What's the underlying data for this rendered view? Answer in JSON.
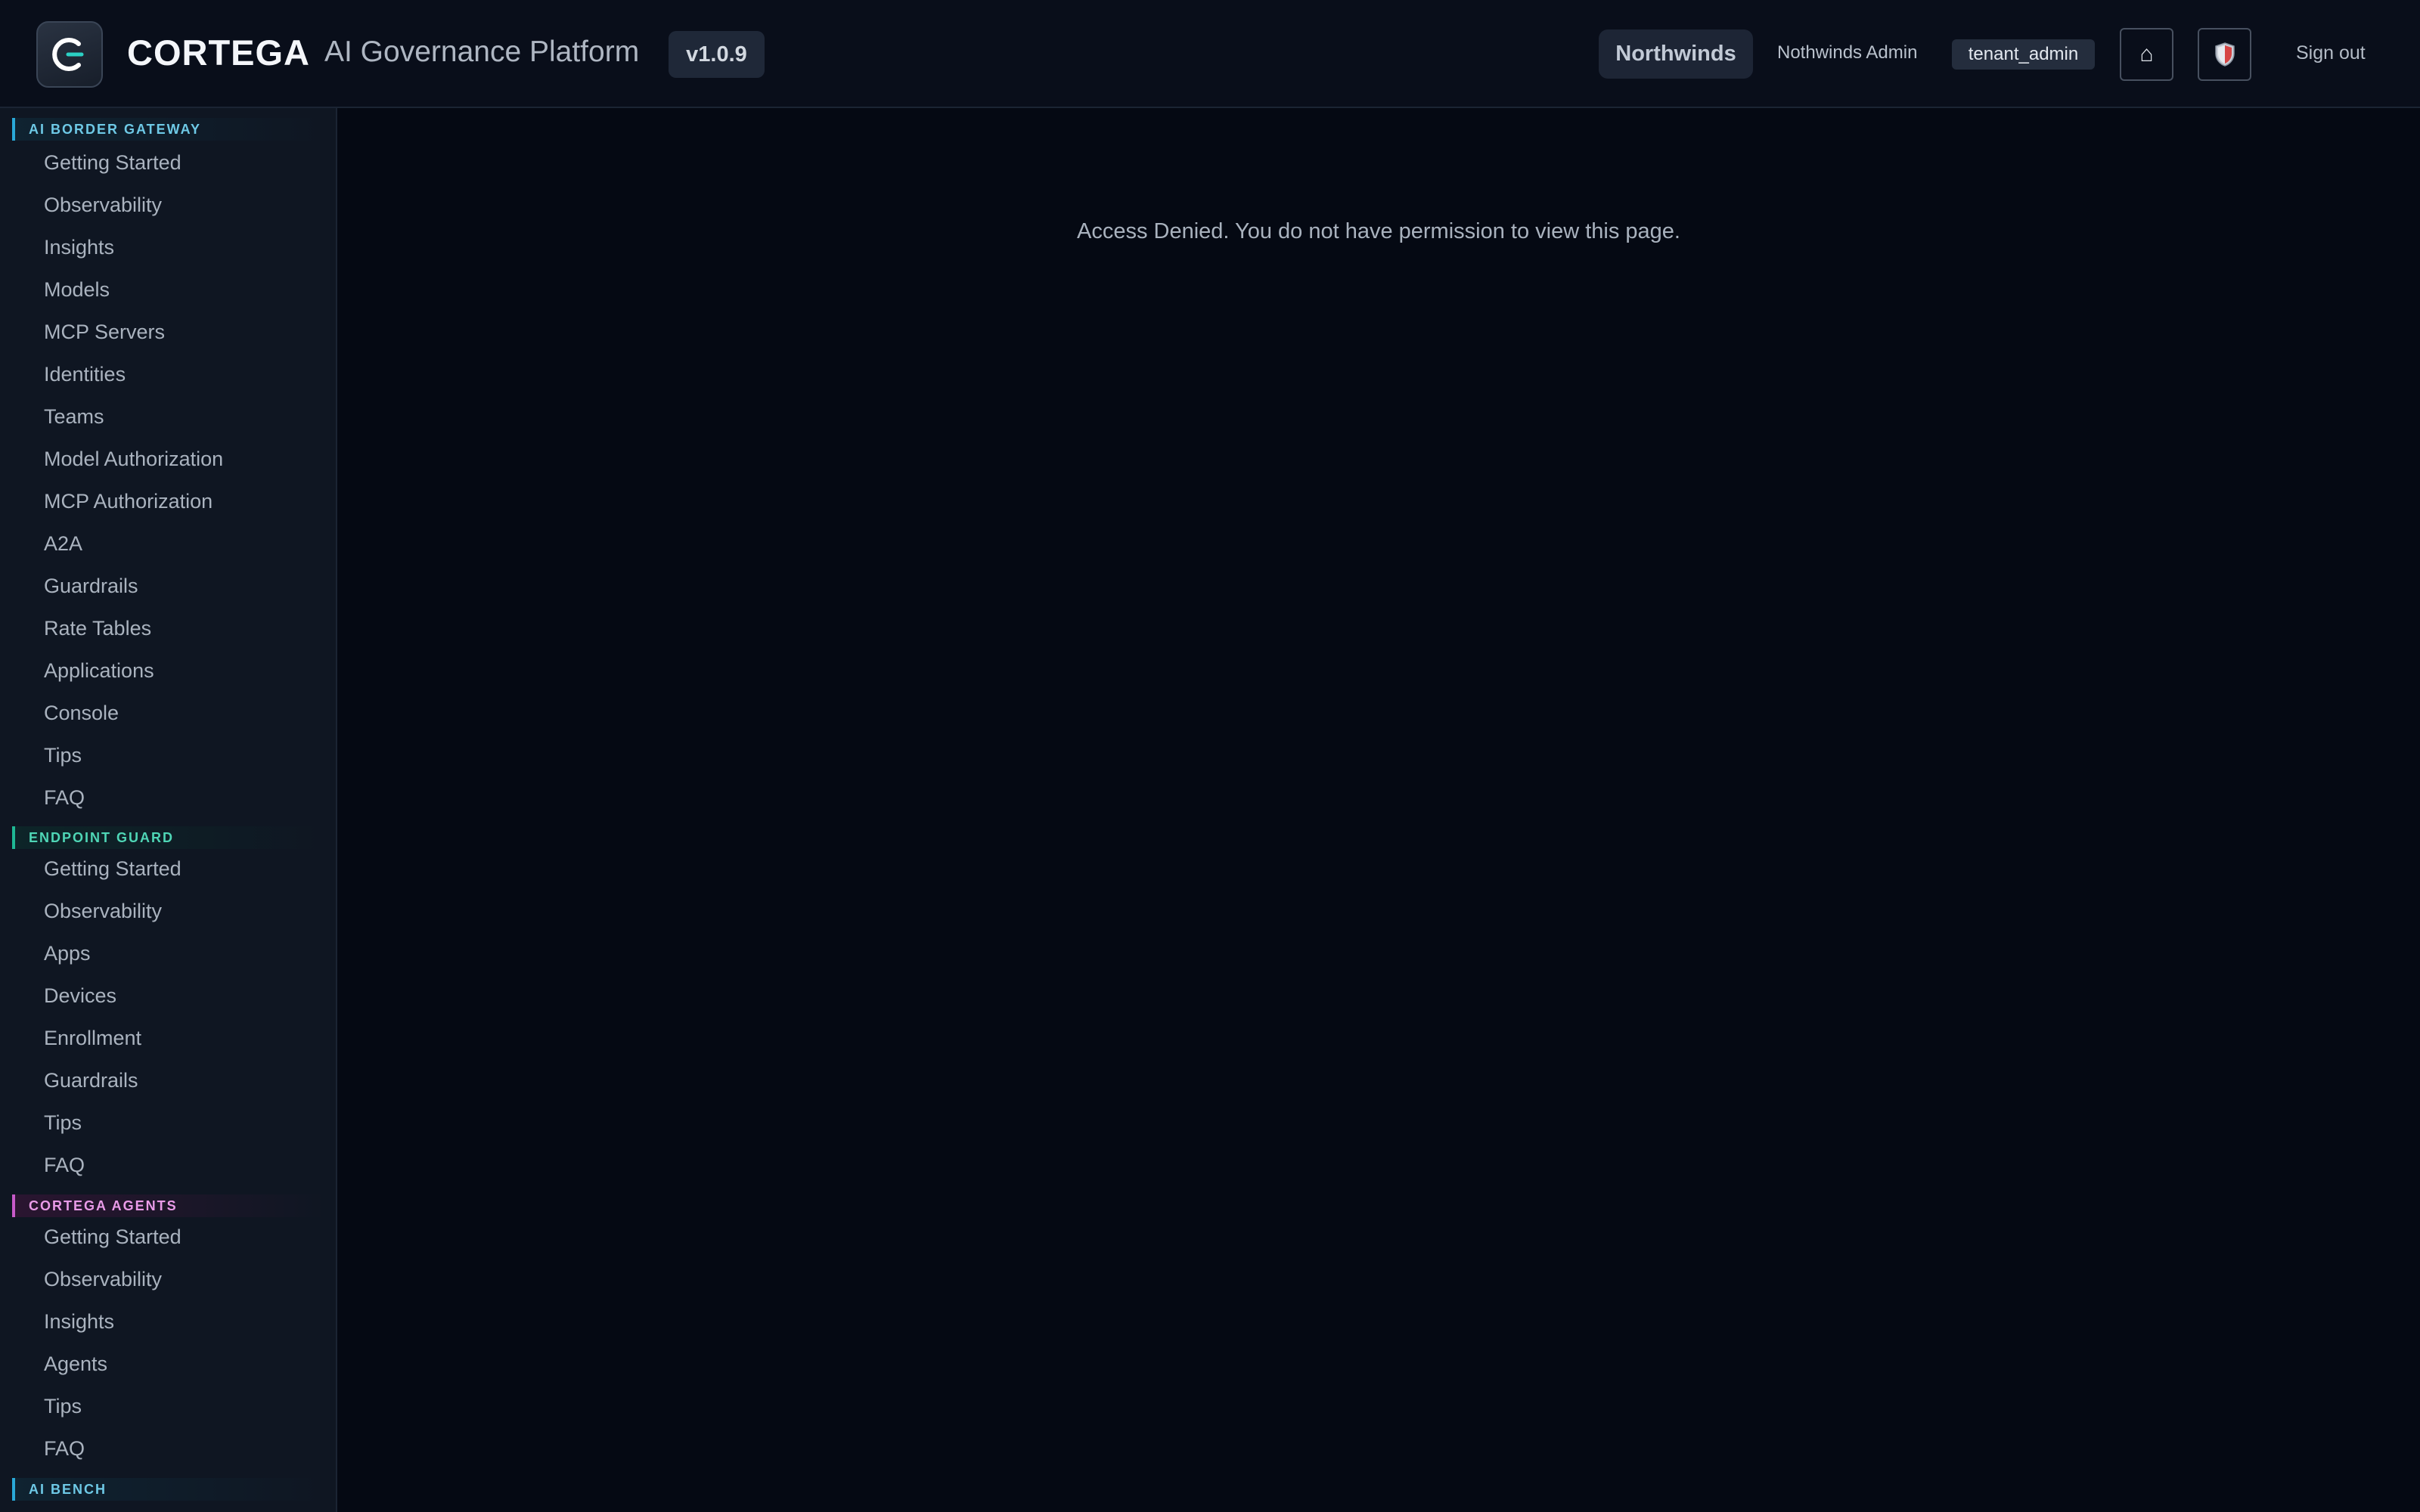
{
  "header": {
    "brand": "CORTEGA",
    "subtitle": "AI Governance Platform",
    "version": "v1.0.9",
    "tenant": "Northwinds",
    "user_name": "Nothwinds Admin",
    "role": "tenant_admin",
    "home_icon": "⌂",
    "sign_out": "Sign out"
  },
  "sidebar": {
    "gateway": {
      "title": "AI BORDER GATEWAY",
      "items": [
        "Getting Started",
        "Observability",
        "Insights",
        "Models",
        "MCP Servers",
        "Identities",
        "Teams",
        "Model Authorization",
        "MCP Authorization",
        "A2A",
        "Guardrails",
        "Rate Tables",
        "Applications",
        "Console",
        "Tips",
        "FAQ"
      ]
    },
    "endpoint": {
      "title": "ENDPOINT GUARD",
      "items": [
        "Getting Started",
        "Observability",
        "Apps",
        "Devices",
        "Enrollment",
        "Guardrails",
        "Tips",
        "FAQ"
      ]
    },
    "agents": {
      "title": "CORTEGA AGENTS",
      "items": [
        "Getting Started",
        "Observability",
        "Insights",
        "Agents",
        "Tips",
        "FAQ"
      ]
    },
    "bench": {
      "title": "AI BENCH"
    }
  },
  "main": {
    "message": "Access Denied. You do not have permission to view this page."
  },
  "colors": {
    "background": "#050913",
    "gateway_accent": "#2aa9d8",
    "endpoint_accent": "#1fb894",
    "agents_accent": "#c75ac9"
  }
}
